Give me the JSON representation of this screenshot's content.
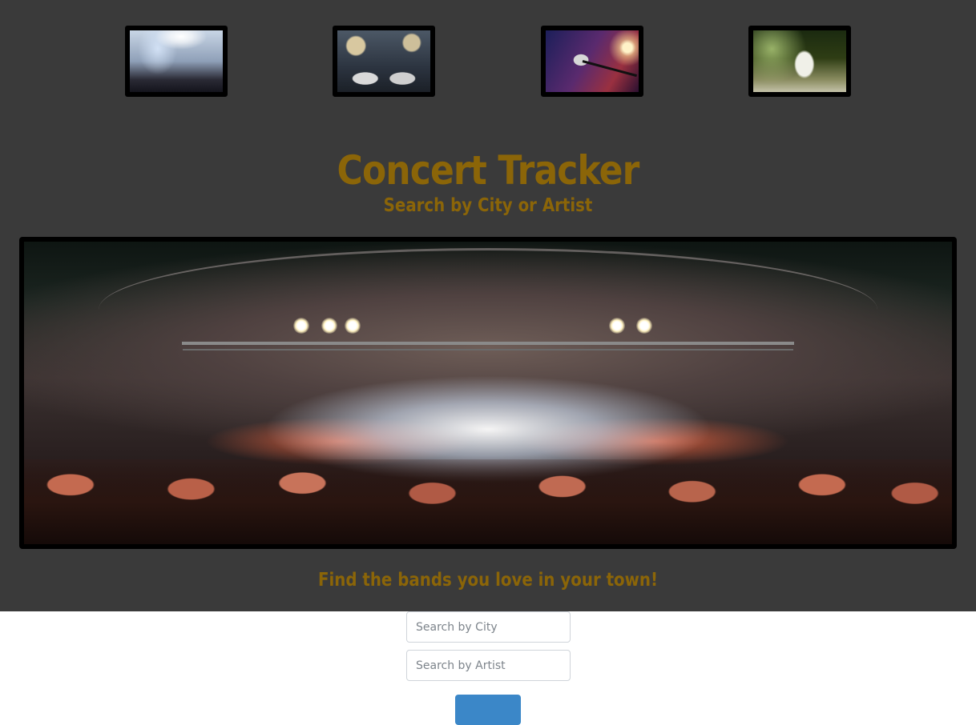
{
  "header": {
    "thumbnails": [
      {
        "icon": "concert-crowd-image"
      },
      {
        "icon": "drum-kit-image"
      },
      {
        "icon": "microphone-image"
      },
      {
        "icon": "guitarist-image"
      }
    ],
    "title": "Concert Tracker",
    "subtitle": "Search by City or Artist"
  },
  "hero": {
    "icon": "outdoor-stage-concert-image"
  },
  "search": {
    "tagline": "Find the bands you love in your town!",
    "city_placeholder": "Search by City",
    "artist_placeholder": "Search by Artist",
    "submit_label": ""
  },
  "colors": {
    "background_dark": "#3a3a3a",
    "accent_gold": "#8b6508",
    "button_blue": "#3b87c8"
  }
}
